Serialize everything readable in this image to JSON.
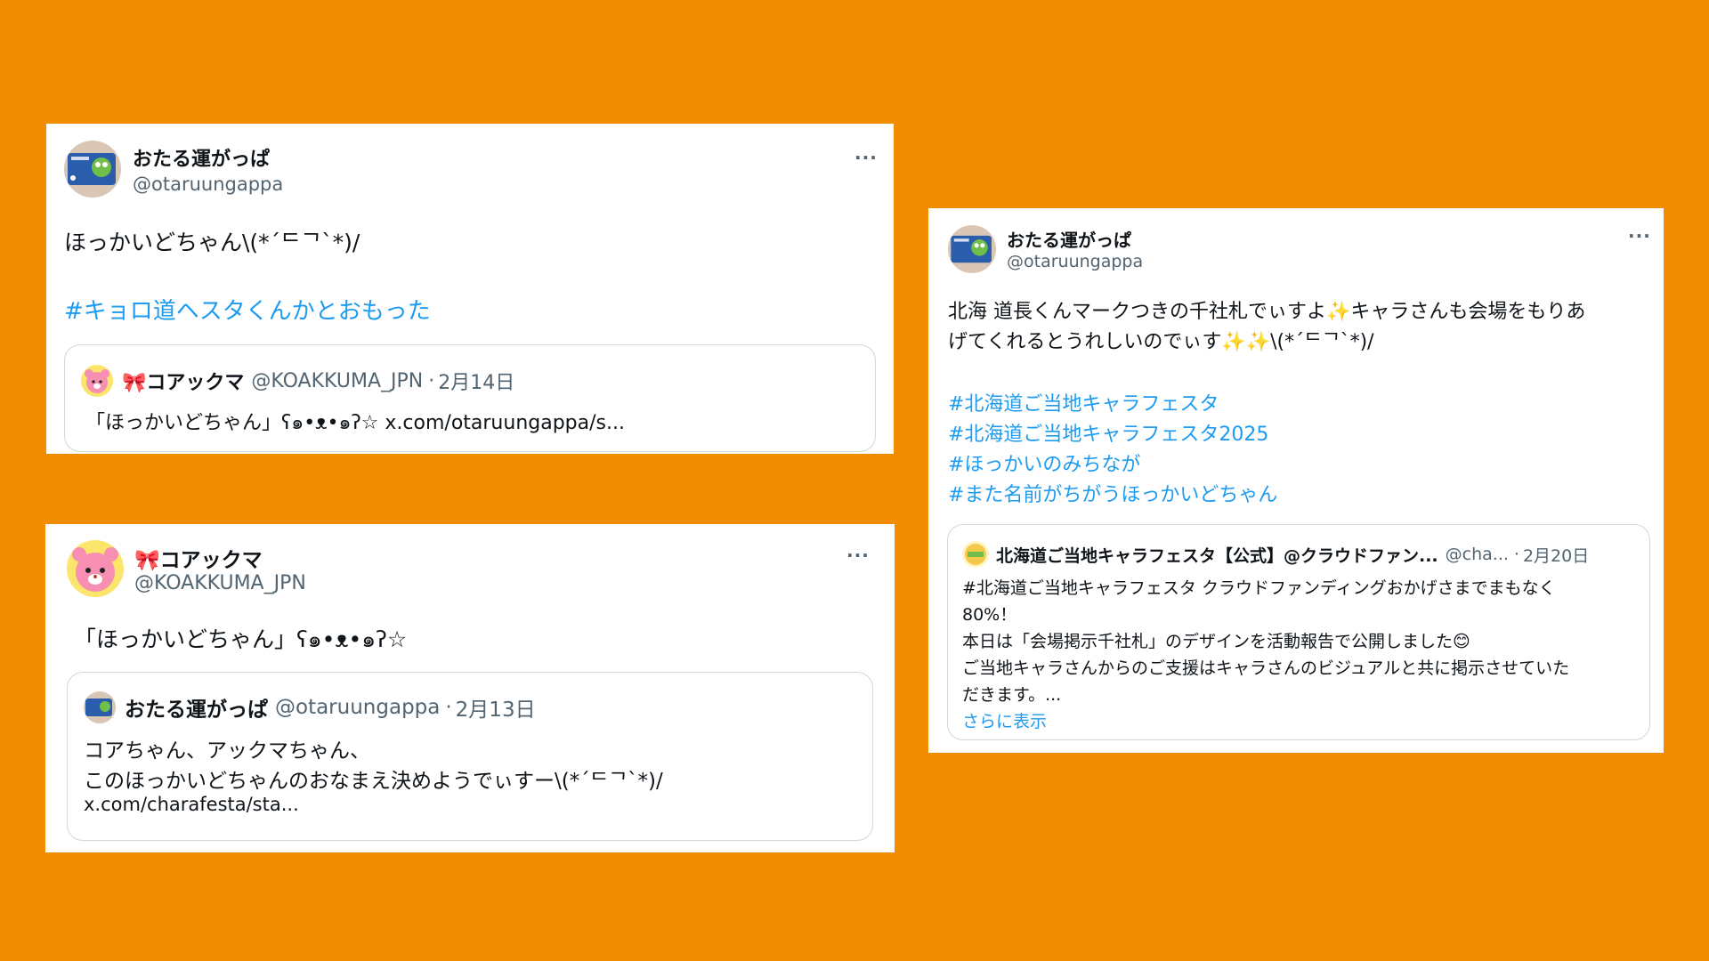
{
  "colors": {
    "background": "#F28C00",
    "link": "#1d9bf0",
    "muted": "#536471"
  },
  "card1": {
    "name": "おたる運がっぱ",
    "handle": "@otaruungappa",
    "more": "···",
    "text": "ほっかいどちゃん\\(*´ᄃᄀ`*)/",
    "hashtag": "#キョロ道ヘスタくんかとおもった",
    "quote": {
      "name": "🎀コアックマ",
      "handle": "@KOAKKUMA_JPN",
      "sep": "·",
      "date": "2月14日",
      "text": "「ほっかいどちゃん」ʕ๑•ᴥ•๑ʔ☆ x.com/otaruungappa/s..."
    }
  },
  "card2": {
    "name": "🎀コアックマ",
    "handle": "@KOAKKUMA_JPN",
    "more": "···",
    "text": "「ほっかいどちゃん」ʕ๑•ᴥ•๑ʔ☆",
    "quote": {
      "name": "おたる運がっぱ",
      "handle": "@otaruungappa",
      "sep": "·",
      "date": "2月13日",
      "line1": "コアちゃん、アックマちゃん、",
      "line2": "このほっかいどちゃんのおなまえ決めようでぃすー\\(*´ᄃᄀ`*)/",
      "line3": "x.com/charafesta/sta..."
    }
  },
  "card3": {
    "name": "おたる運がっぱ",
    "handle": "@otaruungappa",
    "more": "···",
    "line1": "北海 道長くんマークつきの千社札でぃすよ✨キャラさんも会場をもりあ",
    "line2": "げてくれるとうれしいのでぃす✨✨\\(*´ᄃᄀ`*)/",
    "hashtags": [
      "#北海道ご当地キャラフェスタ",
      "#北海道ご当地キャラフェスタ2025",
      "#ほっかいのみちなが",
      "#また名前がちがうほっかいどちゃん"
    ],
    "quote": {
      "name": "北海道ご当地キャラフェスタ【公式】@クラウドファン...",
      "handle": "@cha...",
      "sep": "·",
      "date": "2月20日",
      "line1": "#北海道ご当地キャラフェスタ クラウドファンディングおかげさまでまもなく",
      "line2": "80%！",
      "line3": "本日は「会場掲示千社札」のデザインを活動報告で公開しました😊",
      "line4": "ご当地キャラさんからのご支援はキャラさんのビジュアルと共に掲示させていた",
      "line5": "だきます。...",
      "show_more": "さらに表示"
    }
  }
}
